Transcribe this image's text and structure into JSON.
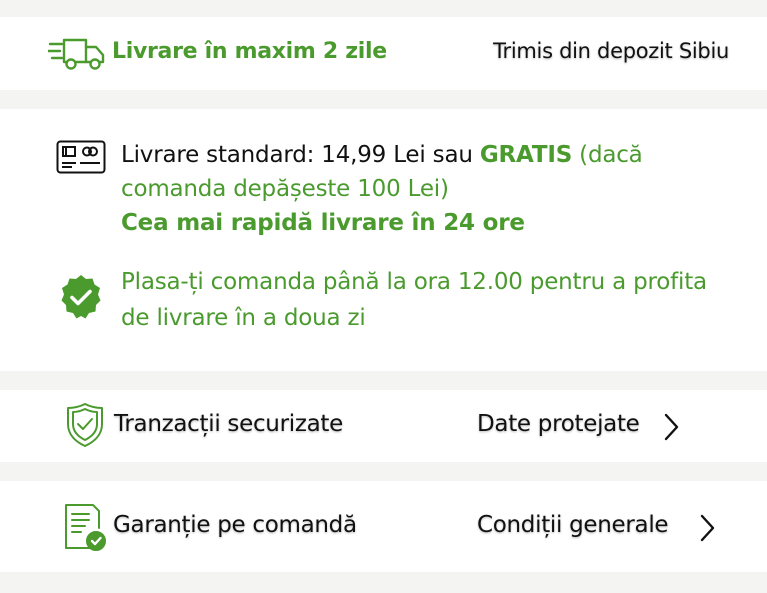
{
  "delivery": {
    "title": "Livrare în maxim 2 zile",
    "depot": "Trimis din depozit Sibiu"
  },
  "shipping": {
    "standard_prefix": "Livrare standard: 14,99 Lei sau ",
    "free": "GRATIS",
    "condition": " (dacă comanda depășeste 100 Lei)",
    "fastest": "Cea mai rapidă livrare în 24 ore",
    "order_note": "Plasa-ți comanda până la ora 12.00 pentru a profita de livrare în a doua zi"
  },
  "security": {
    "left_label": "Tranzacții securizate",
    "right_label": "Date protejate"
  },
  "warranty": {
    "left_label": "Garanție pe comandă",
    "right_label": "Condiții generale"
  },
  "colors": {
    "accent_green": "#4a9a2e",
    "background": "#f4f4f2",
    "card": "#ffffff",
    "text": "#111111"
  },
  "icons": [
    "truck-icon",
    "card-icon",
    "check-badge-icon",
    "shield-check-icon",
    "document-check-icon",
    "chevron-right-icon"
  ]
}
